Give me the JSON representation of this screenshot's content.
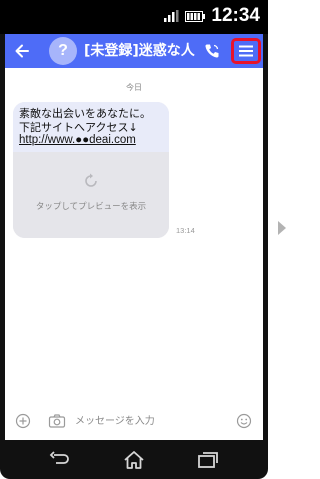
{
  "status_bar": {
    "time": "12:34"
  },
  "app_bar": {
    "avatar_glyph": "?",
    "title": "[未登録]迷惑な人"
  },
  "chat": {
    "date_separator": "今日",
    "message": {
      "lines": [
        "素敵な出会いをあなたに。",
        "下記サイトへアクセス↓"
      ],
      "link": "http://www.●●deai.com",
      "preview_label": "タップしてプレビューを表示",
      "time": "13:14"
    }
  },
  "input_bar": {
    "placeholder": "メッセージを入力"
  },
  "colors": {
    "app_bar": "#4e6cf7",
    "highlight": "#e8122a",
    "bubble": "#e8ebf9",
    "preview": "#e5e5ea"
  }
}
